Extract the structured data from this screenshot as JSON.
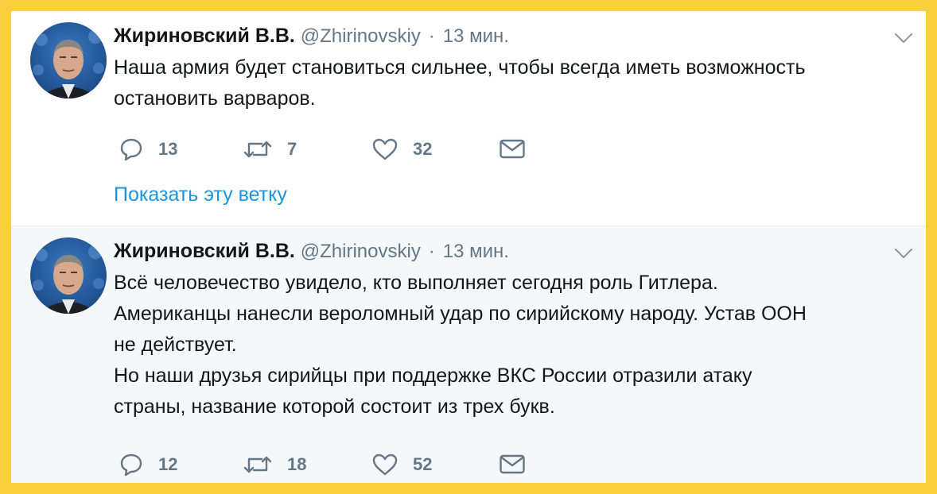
{
  "tweets": [
    {
      "author_name": "Жириновский В.В.",
      "handle": "@Zhirinovskiy",
      "separator": "·",
      "time": "13 мин.",
      "text": "Наша армия будет становиться сильнее, чтобы всегда иметь возможность\nостановить варваров.",
      "replies": "13",
      "retweets": "7",
      "likes": "32",
      "show_thread": "Показать эту ветку"
    },
    {
      "author_name": "Жириновский В.В.",
      "handle": "@Zhirinovskiy",
      "separator": "·",
      "time": "13 мин.",
      "text": "Всё человечество увидело, кто выполняет сегодня роль Гитлера.\nАмериканцы нанесли вероломный удар по сирийскому народу. Устав ООН\nне действует.\nНо наши друзья сирийцы при поддержке ВКС России отразили атаку\nстраны, название которой состоит из трех букв.",
      "replies": "12",
      "retweets": "18",
      "likes": "52"
    }
  ],
  "icons": {
    "reply": "reply-icon",
    "retweet": "retweet-icon",
    "like": "heart-icon",
    "dm": "envelope-icon",
    "menu": "chevron-down-icon"
  },
  "colors": {
    "border_yellow": "#F9CF3F",
    "text": "#14171A",
    "muted": "#657786",
    "link": "#1B95E0",
    "selected_bg": "#F5F8FA"
  }
}
